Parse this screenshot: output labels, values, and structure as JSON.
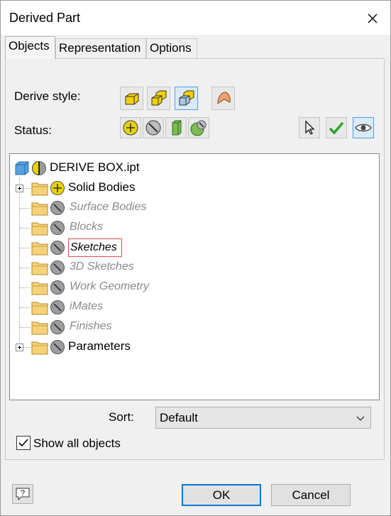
{
  "window": {
    "title": "Derived Part"
  },
  "tabs": [
    {
      "label": "Objects",
      "active": true
    },
    {
      "label": "Representation",
      "active": false
    },
    {
      "label": "Options",
      "active": false
    }
  ],
  "derive_style": {
    "label": "Derive style:",
    "buttons": [
      {
        "icon": "merge-solid-body-icon",
        "selected": false
      },
      {
        "icon": "multiple-solid-bodies-icon",
        "selected": false
      },
      {
        "icon": "keep-seams-body-icon",
        "selected": true
      },
      {
        "icon": "surface-body-icon",
        "selected": false
      }
    ]
  },
  "status": {
    "label": "Status:",
    "buttons": [
      {
        "icon": "include-icon"
      },
      {
        "icon": "exclude-icon"
      },
      {
        "icon": "body-as-work-surface-icon"
      },
      {
        "icon": "mixed-icon"
      }
    ],
    "right_buttons": [
      {
        "icon": "select-cursor-icon"
      },
      {
        "icon": "checkmark-icon"
      },
      {
        "icon": "eye-icon"
      }
    ]
  },
  "tree": {
    "root": {
      "label": "DERIVE BOX.ipt"
    },
    "items": [
      {
        "label": "Solid Bodies",
        "state": "include",
        "expandable": true,
        "dim": false
      },
      {
        "label": "Surface Bodies",
        "state": "exclude",
        "expandable": false,
        "dim": true
      },
      {
        "label": "Blocks",
        "state": "exclude",
        "expandable": false,
        "dim": true
      },
      {
        "label": "Sketches",
        "state": "exclude",
        "expandable": false,
        "dim": true,
        "focused": true
      },
      {
        "label": "3D Sketches",
        "state": "exclude",
        "expandable": false,
        "dim": true
      },
      {
        "label": "Work Geometry",
        "state": "exclude",
        "expandable": false,
        "dim": true
      },
      {
        "label": "iMates",
        "state": "exclude",
        "expandable": false,
        "dim": true
      },
      {
        "label": "Finishes",
        "state": "exclude",
        "expandable": false,
        "dim": true
      },
      {
        "label": "Parameters",
        "state": "exclude",
        "expandable": true,
        "dim": false
      }
    ]
  },
  "sort": {
    "label": "Sort:",
    "value": "Default"
  },
  "show_all": {
    "label": "Show all objects",
    "checked": true
  },
  "footer": {
    "ok_label": "OK",
    "cancel_label": "Cancel",
    "help_icon": "help-icon"
  },
  "colors": {
    "accent": "#0078d7",
    "focus_border": "#e05050",
    "folder": "#f5d27a",
    "include": "#e8d200"
  }
}
